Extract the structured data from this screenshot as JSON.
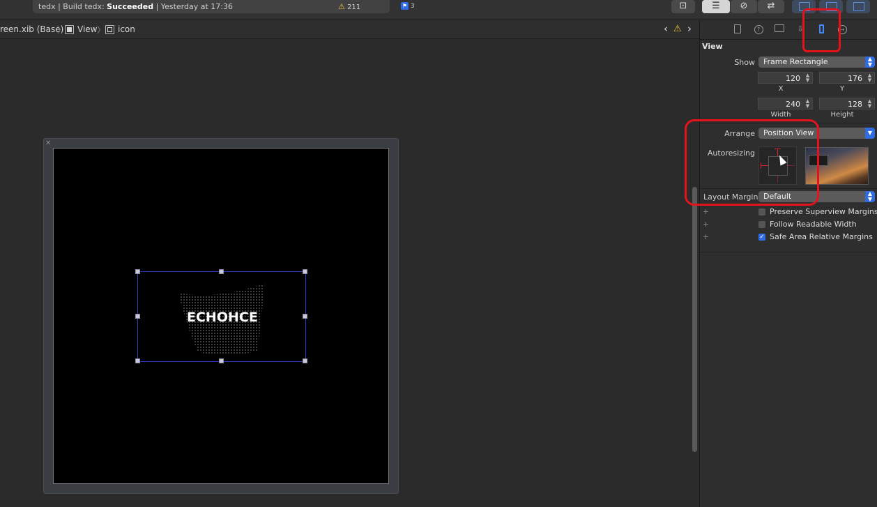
{
  "toolbar": {
    "activity_prefix": "tedx | Build tedx: ",
    "activity_status": "Succeeded",
    "activity_suffix": " | Yesterday at 17:36",
    "warning_count": "211",
    "issue_count": "3"
  },
  "jumpbar": {
    "crumbs": [
      "reen.xib (Base)",
      "View",
      "icon"
    ]
  },
  "canvas": {
    "logo_text": "ECHOHCE"
  },
  "inspector": {
    "section": "View",
    "show_label": "Show",
    "show_value": "Frame Rectangle",
    "x_value": "120",
    "y_value": "176",
    "x_label": "X",
    "y_label": "Y",
    "width_value": "240",
    "height_value": "128",
    "width_label": "Width",
    "height_label": "Height",
    "arrange_label": "Arrange",
    "arrange_value": "Position View",
    "autoresizing_label": "Autoresizing",
    "layout_margins_label": "Layout Margins",
    "layout_margins_value": "Default",
    "checks": [
      {
        "label": "Preserve Superview Margins",
        "checked": false
      },
      {
        "label": "Follow Readable Width",
        "checked": false
      },
      {
        "label": "Safe Area Relative Margins",
        "checked": true
      }
    ]
  },
  "colors": {
    "accent": "#2f6be3",
    "annotation": "#e3141c",
    "warning": "#f5c242"
  }
}
